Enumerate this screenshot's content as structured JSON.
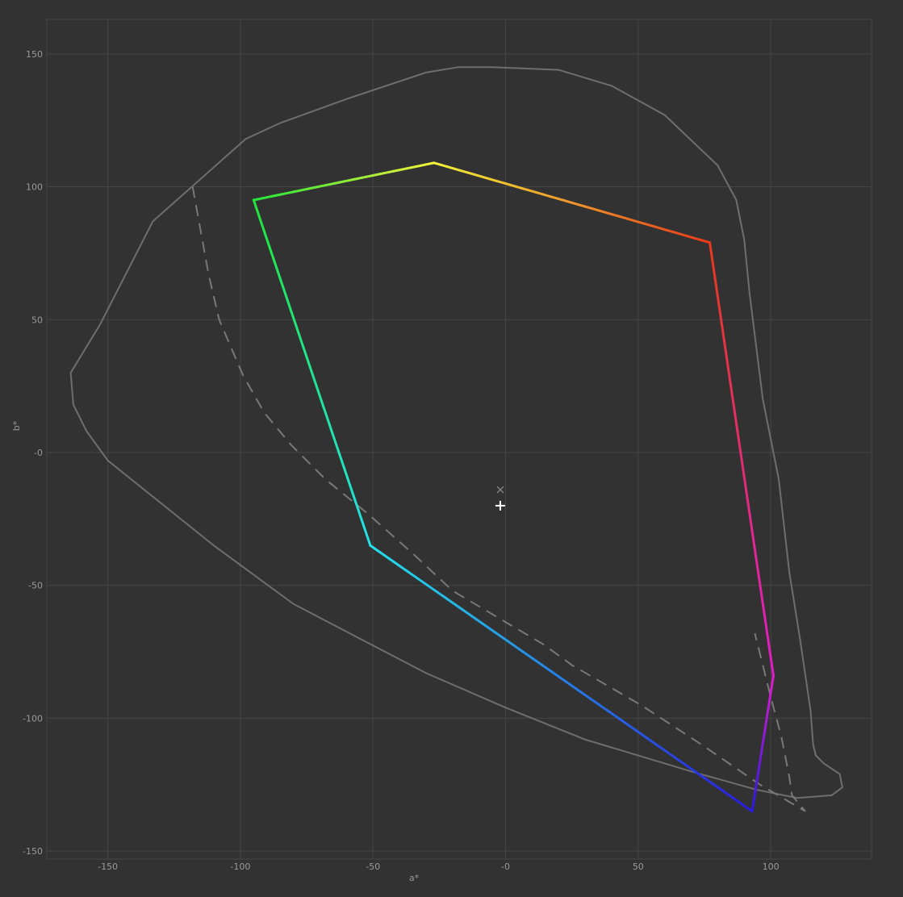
{
  "chart_data": {
    "type": "line",
    "title": "",
    "xlabel": "a*",
    "ylabel": "b*",
    "xlim": [
      -173,
      138
    ],
    "ylim": [
      -153,
      163
    ],
    "grid": true,
    "x_ticks": [
      -150,
      -100,
      -50,
      0,
      50,
      100
    ],
    "x_tick_labels": [
      "-150",
      "-100",
      "-50",
      "-0",
      "50",
      "100"
    ],
    "y_ticks": [
      150,
      100,
      50,
      0,
      -50,
      -100,
      -150
    ],
    "y_tick_labels": [
      "150",
      "100",
      "50",
      "-0",
      "-50",
      "-100",
      "-150"
    ],
    "colors": {
      "background": "#323232",
      "grid": "#454545",
      "reference": "#767676",
      "marker": "#ffffff",
      "marker_faint": "#8c8c8c"
    },
    "series": [
      {
        "style": "solid",
        "color": "#6e6e6e",
        "x": [
          -18,
          -30,
          -60,
          -85,
          -98,
          -133,
          -153,
          -164,
          -163,
          -158,
          -150,
          -110,
          -80,
          -55,
          -30,
          0,
          30,
          70,
          95,
          110,
          123,
          127,
          126,
          120,
          117,
          116,
          115,
          111,
          107,
          103,
          97,
          92,
          90,
          88,
          87,
          80,
          60,
          40,
          20,
          -5
        ],
        "y": [
          145,
          143,
          133,
          124,
          118,
          87,
          48,
          30,
          18,
          8,
          -3,
          -35,
          -57,
          -70,
          -83,
          -96,
          -108,
          -120,
          -127,
          -130,
          -129,
          -126,
          -121,
          -117,
          -114,
          -110,
          -97,
          -70,
          -45,
          -10,
          20,
          60,
          80,
          90,
          95,
          108,
          127,
          138,
          144,
          145
        ]
      },
      {
        "style": "dashed",
        "color": "#787878",
        "x": [
          -118,
          -112,
          -108,
          -99,
          -91,
          -81,
          -68,
          -52,
          -35,
          -20,
          2,
          14,
          25,
          51,
          74,
          96,
          113,
          108,
          107,
          104,
          100,
          94
        ],
        "y": [
          100,
          67,
          50,
          29,
          15,
          3,
          -10,
          -23,
          -38,
          -52,
          -65,
          -72,
          -80,
          -95,
          -110,
          -125,
          -135,
          -129,
          -122,
          -107,
          -92,
          -68
        ]
      },
      {
        "name": "",
        "style": "solid",
        "gradient": true,
        "closed": true,
        "vertices": [
          {
            "x": -95,
            "y": 95,
            "color": "#22e53a"
          },
          {
            "x": -27,
            "y": 109,
            "color": "#f2f23a"
          },
          {
            "x": 77,
            "y": 79,
            "color": "#e83a1a"
          },
          {
            "x": 101,
            "y": -84,
            "color": "#e01ec8"
          },
          {
            "x": 93,
            "y": -135,
            "color": "#2a1ae0"
          },
          {
            "x": -51,
            "y": -35,
            "color": "#22e2e8"
          }
        ]
      }
    ],
    "markers": [
      {
        "symbol": "plus",
        "x": -2,
        "y": -20
      },
      {
        "symbol": "cross",
        "x": -2,
        "y": -14
      }
    ]
  }
}
